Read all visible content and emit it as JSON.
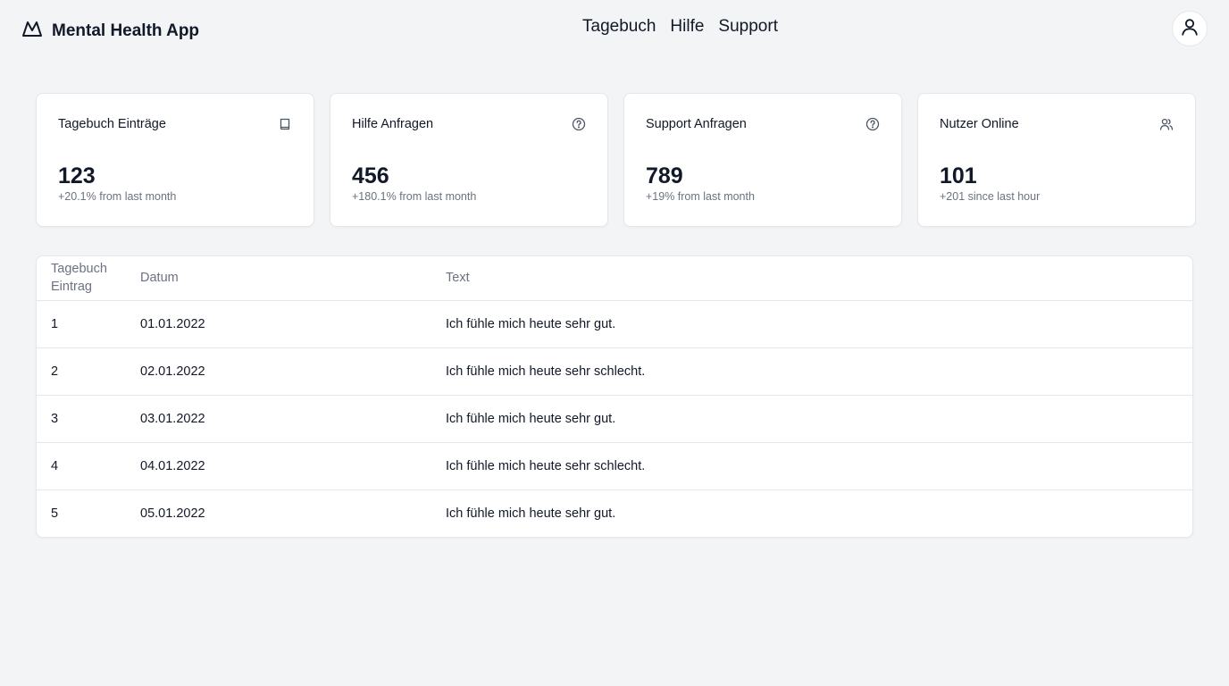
{
  "app": {
    "title": "Mental Health App"
  },
  "nav": {
    "items": [
      "Tagebuch",
      "Hilfe",
      "Support"
    ]
  },
  "stats": [
    {
      "title": "Tagebuch Einträge",
      "value": "123",
      "sub": "+20.1% from last month",
      "icon": "book-icon"
    },
    {
      "title": "Hilfe Anfragen",
      "value": "456",
      "sub": "+180.1% from last month",
      "icon": "help-circle-icon"
    },
    {
      "title": "Support Anfragen",
      "value": "789",
      "sub": "+19% from last month",
      "icon": "help-circle-icon"
    },
    {
      "title": "Nutzer Online",
      "value": "101",
      "sub": "+201 since last hour",
      "icon": "users-icon"
    }
  ],
  "table": {
    "headers": [
      "Tagebuch Eintrag",
      "Datum",
      "Text"
    ],
    "rows": [
      [
        "1",
        "01.01.2022",
        "Ich fühle mich heute sehr gut."
      ],
      [
        "2",
        "02.01.2022",
        "Ich fühle mich heute sehr schlecht."
      ],
      [
        "3",
        "03.01.2022",
        "Ich fühle mich heute sehr gut."
      ],
      [
        "4",
        "04.01.2022",
        "Ich fühle mich heute sehr schlecht."
      ],
      [
        "5",
        "05.01.2022",
        "Ich fühle mich heute sehr gut."
      ]
    ]
  },
  "colors": {
    "background": "#f3f4f6",
    "card": "#ffffff",
    "text": "#111827",
    "muted": "#6b7280",
    "border": "#e5e7eb"
  }
}
